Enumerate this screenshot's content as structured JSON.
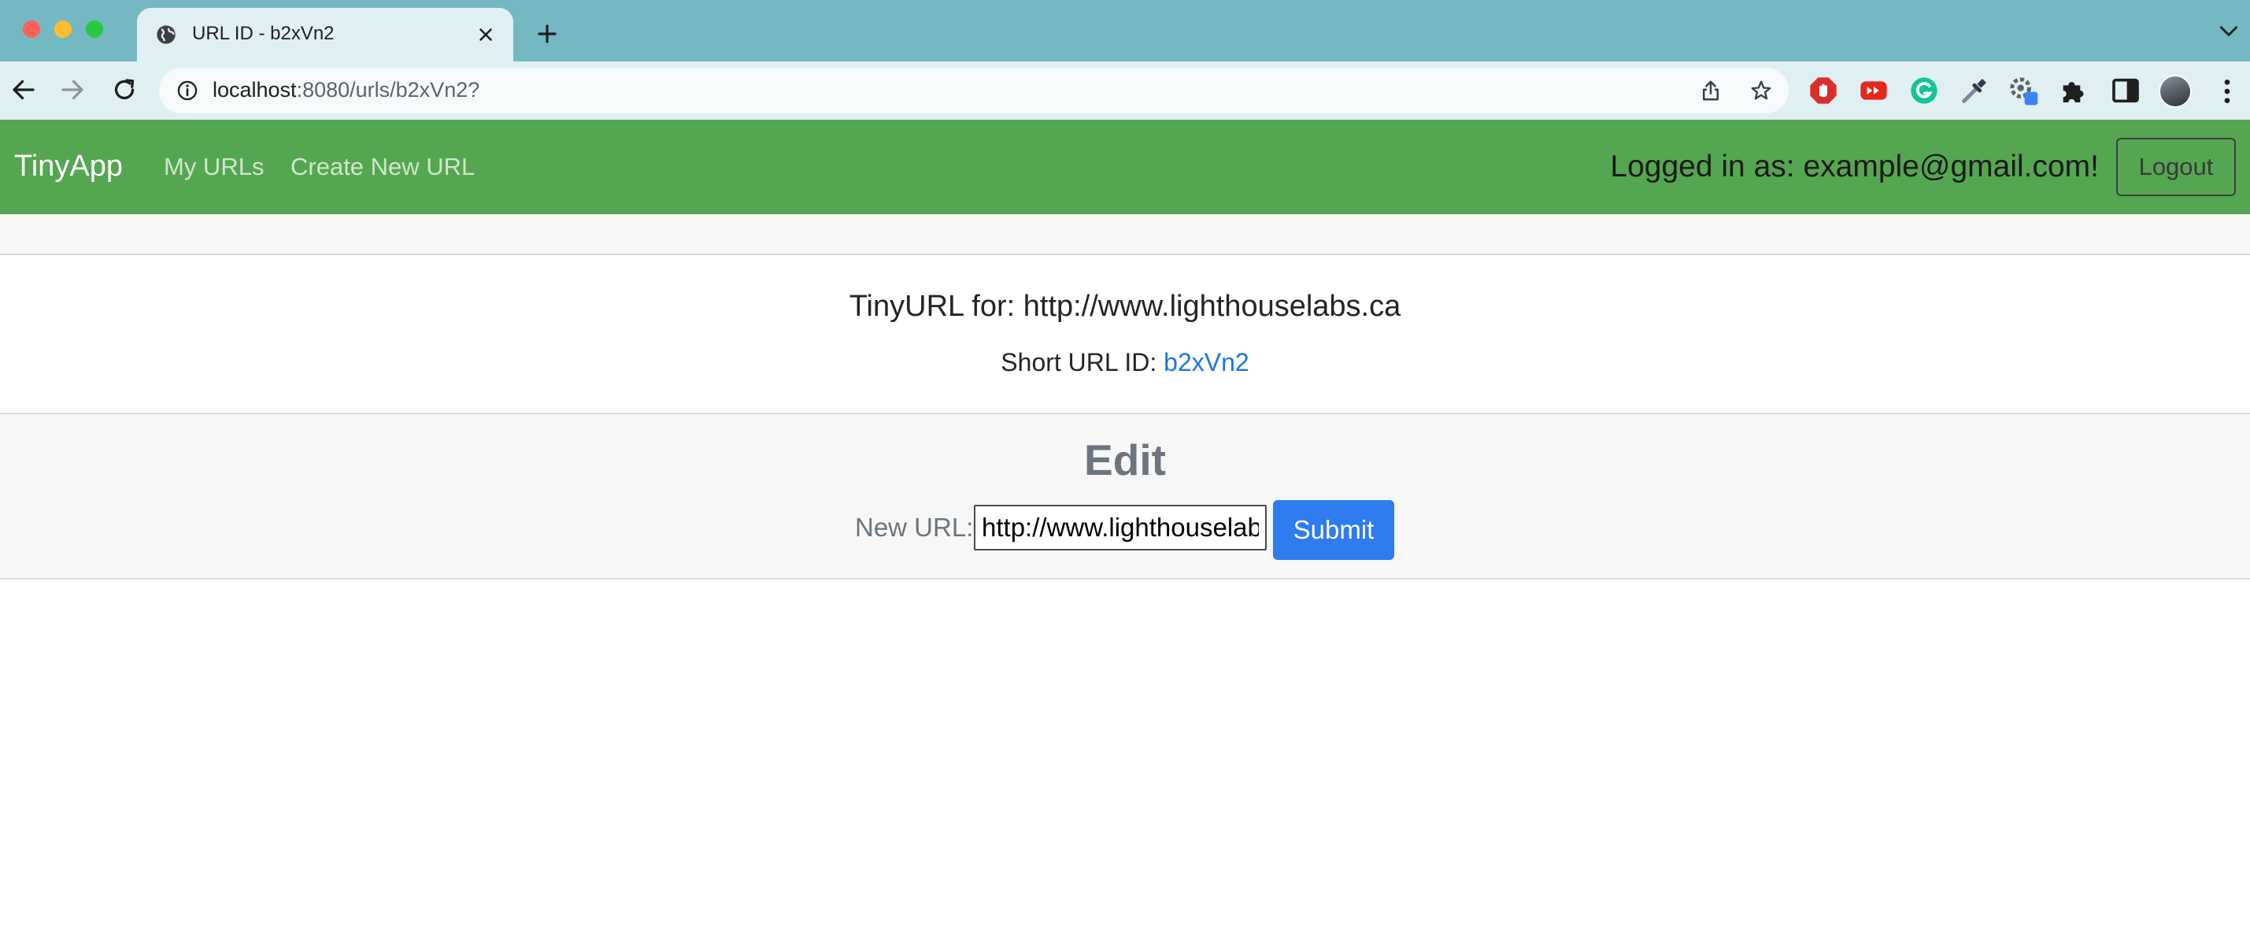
{
  "browser": {
    "tab": {
      "title": "URL ID - b2xVn2"
    },
    "address_bar": {
      "host": "localhost",
      "path": ":8080/urls/b2xVn2?"
    },
    "colors": {
      "tabstrip": "#74b8c2",
      "toolbar": "#e0f0f2"
    }
  },
  "navbar": {
    "brand": "TinyApp",
    "links": [
      {
        "label": "My URLs"
      },
      {
        "label": "Create New URL"
      }
    ],
    "logged_in_text": "Logged in as: example@gmail.com!",
    "logout_label": "Logout",
    "color": "#55a650"
  },
  "url_info": {
    "heading": "TinyURL for: http://www.lighthouselabs.ca",
    "short_label": "Short URL ID: ",
    "short_id": "b2xVn2"
  },
  "edit": {
    "title": "Edit",
    "label": "New URL:",
    "input_value": "http://www.lighthouselabs.ca",
    "submit_label": "Submit",
    "submit_color": "#2f7bf0"
  }
}
